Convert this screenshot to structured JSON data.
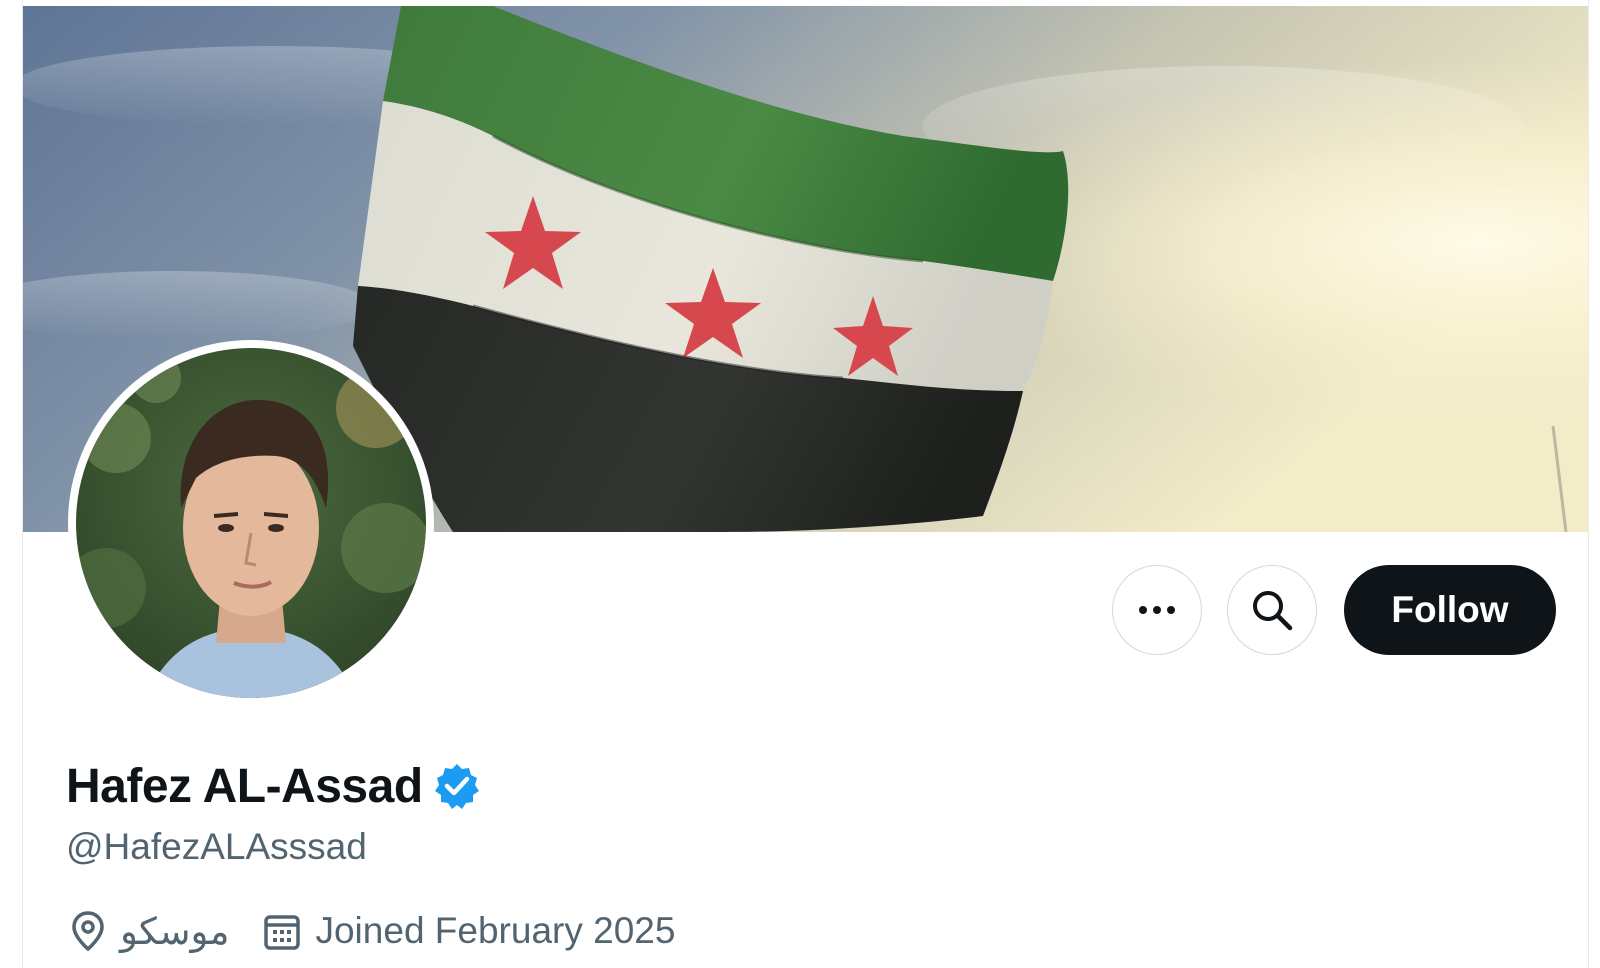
{
  "profile": {
    "display_name": "Hafez AL-Assad",
    "handle": "@HafezALAsssad",
    "verified": true,
    "location": "موسكو",
    "joined": "Joined February 2025"
  },
  "actions": {
    "more_icon": "more-horizontal-icon",
    "search_icon": "search-icon",
    "follow_label": "Follow"
  },
  "icons": {
    "location": "location-pin-icon",
    "calendar": "calendar-icon",
    "verified": "verified-badge-icon"
  },
  "colors": {
    "primary_text": "#0f1419",
    "secondary_text": "#536471",
    "verified_blue": "#1d9bf0",
    "follow_bg": "#0f1419",
    "border": "#cfd9de"
  }
}
